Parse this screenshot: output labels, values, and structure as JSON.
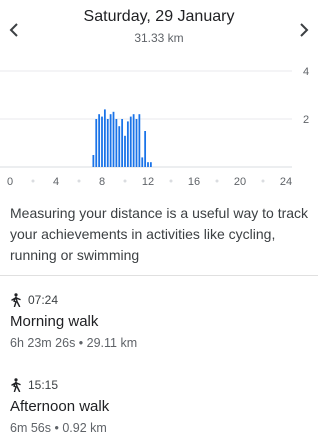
{
  "header": {
    "date": "Saturday, 29 January",
    "total_distance": "31.33 km"
  },
  "chart_data": {
    "type": "bar",
    "x_ticks": [
      "0",
      "4",
      "8",
      "12",
      "16",
      "20",
      "24"
    ],
    "y_ticks": [
      "2",
      "4"
    ],
    "ylim": [
      0,
      4
    ],
    "xlim": [
      0,
      24
    ],
    "grid": true,
    "bar_color": "#1a73e8",
    "x": [
      7.25,
      7.5,
      7.75,
      8.0,
      8.25,
      8.5,
      8.75,
      9.0,
      9.25,
      9.5,
      9.75,
      10.0,
      10.25,
      10.5,
      10.75,
      11.0,
      11.25,
      11.5,
      11.75,
      12.0,
      12.25,
      12.5,
      12.75,
      13.0,
      13.25,
      13.5,
      13.75,
      14.0,
      14.25,
      14.5,
      14.75,
      15.0,
      15.25,
      15.5,
      15.75
    ],
    "values": [
      0.5,
      2.0,
      2.2,
      2.1,
      2.4,
      2.0,
      2.2,
      2.3,
      2.0,
      1.7,
      2.0,
      1.3,
      1.9,
      2.1,
      2.2,
      2.0,
      2.2,
      0.4,
      1.5,
      0.2,
      0.2,
      0.0,
      0.0,
      0.0,
      0.0,
      0.0,
      0.0,
      0.0,
      0.0,
      0.0,
      0.0,
      0.0,
      0.0,
      0.0,
      0.0
    ]
  },
  "description": "Measuring your distance is a useful way to track your achievements in activities like cycling, running or swimming",
  "activities": [
    {
      "time": "07:24",
      "name": "Morning walk",
      "stats": "6h 23m 26s  •  29.11 km"
    },
    {
      "time": "15:15",
      "name": "Afternoon walk",
      "stats": "6m 56s  •  0.92 km"
    }
  ],
  "icons": {
    "prev": "chevron-left-icon",
    "next": "chevron-right-icon",
    "activity": "walking-icon"
  }
}
